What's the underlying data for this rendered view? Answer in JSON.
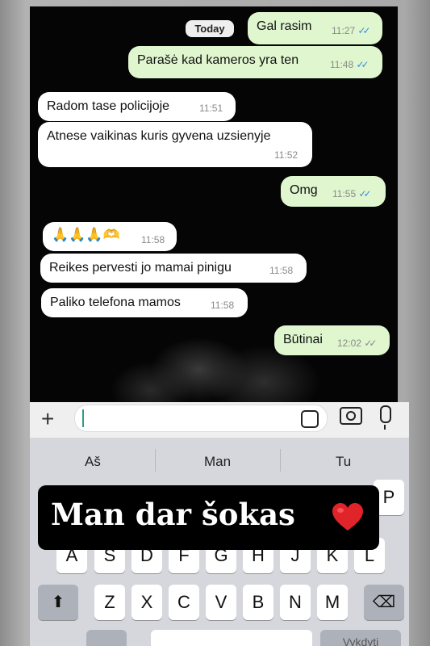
{
  "chat": {
    "date_label": "Today",
    "messages": [
      {
        "dir": "out",
        "text": "Gal rasim",
        "time": "11:27",
        "ticks": "read"
      },
      {
        "dir": "out",
        "text": "Parašė kad kameros yra ten",
        "time": "11:48",
        "ticks": "read"
      },
      {
        "dir": "in",
        "text": "Radom tase policijoje",
        "time": "11:51"
      },
      {
        "dir": "in",
        "text": "Atnese vaikinas kuris gyvena uzsienyje",
        "time": "11:52"
      },
      {
        "dir": "out",
        "text": "Omg",
        "time": "11:55",
        "ticks": "read"
      },
      {
        "dir": "in",
        "text": "🙏🙏🙏🫶",
        "time": "11:58"
      },
      {
        "dir": "in",
        "text": "Reikes pervesti jo mamai pinigu",
        "time": "11:58"
      },
      {
        "dir": "in",
        "text": "Paliko telefona mamos",
        "time": "11:58"
      },
      {
        "dir": "out",
        "text": "Būtinai",
        "time": "12:02",
        "ticks": "sent"
      }
    ]
  },
  "input_bar": {
    "plus_icon": "plus-icon",
    "sticker_icon": "sticker-icon",
    "camera_icon": "camera-icon",
    "mic_icon": "microphone-icon",
    "value": ""
  },
  "keyboard": {
    "suggestions": [
      "Aš",
      "Man",
      "Tu"
    ],
    "row1_visible": [
      "P"
    ],
    "row2_visible": [
      "A",
      "S",
      "D",
      "F",
      "G",
      "H",
      "J",
      "K",
      "L"
    ],
    "row3": [
      "Z",
      "X",
      "C",
      "V",
      "B",
      "N",
      "M"
    ],
    "shift_icon": "shift-icon",
    "backspace_icon": "backspace-icon",
    "bottom_right_label": "Vykdyti"
  },
  "overlay": {
    "text": "Man dar šokas",
    "emoji_icon": "red-heart-icon"
  },
  "colors": {
    "incoming_bubble": "#ffffff",
    "outgoing_bubble": "#dff6cf",
    "read_ticks": "#3b8be0",
    "chat_background": "#050505"
  }
}
